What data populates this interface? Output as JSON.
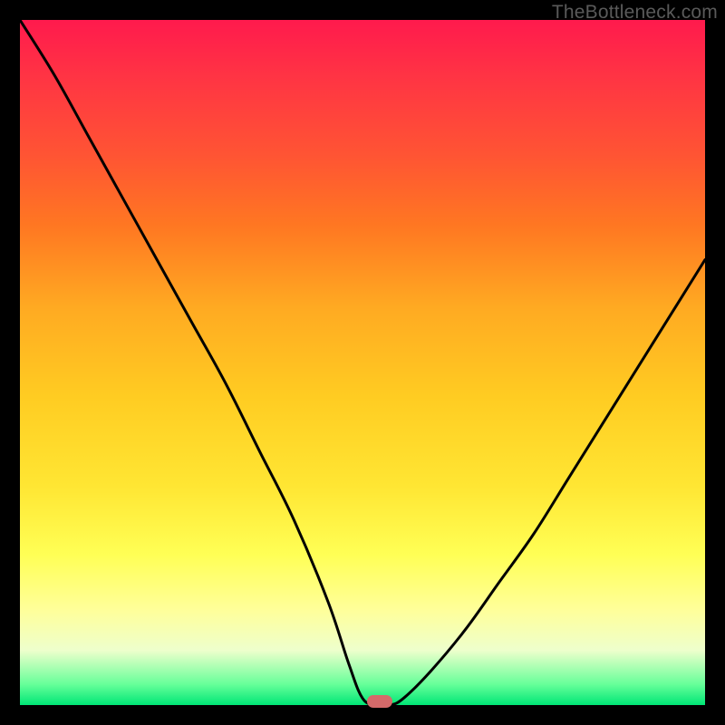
{
  "watermark": "TheBottleneck.com",
  "chart_data": {
    "type": "line",
    "title": "",
    "xlabel": "",
    "ylabel": "",
    "xlim": [
      0,
      100
    ],
    "ylim": [
      0,
      100
    ],
    "grid": false,
    "legend": false,
    "series": [
      {
        "name": "bottleneck-curve",
        "x": [
          0,
          5,
          10,
          15,
          20,
          25,
          30,
          35,
          40,
          45,
          48,
          50,
          52,
          54,
          56,
          60,
          65,
          70,
          75,
          80,
          85,
          90,
          95,
          100
        ],
        "y": [
          100,
          92,
          83,
          74,
          65,
          56,
          47,
          37,
          27,
          15,
          6,
          1,
          0,
          0,
          1,
          5,
          11,
          18,
          25,
          33,
          41,
          49,
          57,
          65
        ]
      }
    ],
    "marker": {
      "x": 52.5,
      "y": 0.5
    },
    "background_gradient": {
      "stops": [
        {
          "pos": 0,
          "color": "#ff1a4d"
        },
        {
          "pos": 50,
          "color": "#ffcc22"
        },
        {
          "pos": 80,
          "color": "#ffff55"
        },
        {
          "pos": 100,
          "color": "#00e676"
        }
      ]
    }
  }
}
